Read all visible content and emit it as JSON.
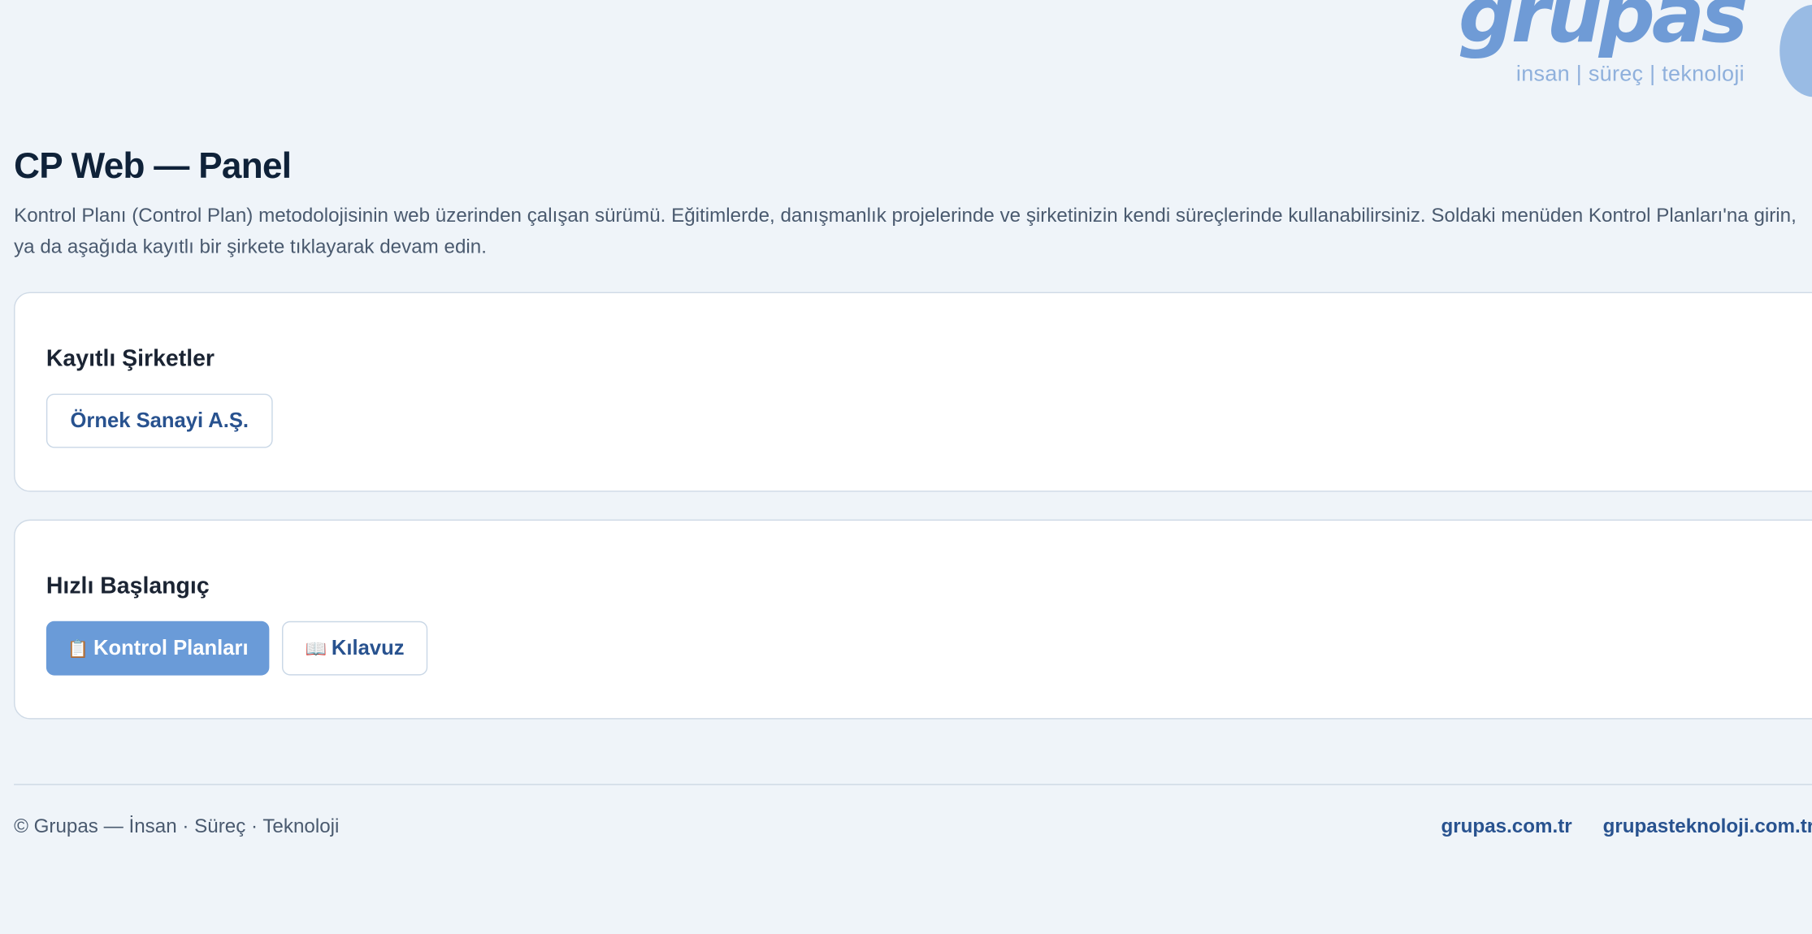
{
  "logo": {
    "word": "grupas",
    "tagline": "insan | süreç | teknoloji"
  },
  "page": {
    "title": "CP Web — Panel",
    "intro": "Kontrol Planı (Control Plan) metodolojisinin web üzerinden çalışan sürümü. Eğitimlerde, danışmanlık projelerinde ve şirketinizin kendi süreçlerinde kullanabilirsiniz. Soldaki menüden Kontrol Planları'na girin, ya da aşağıda kayıtlı bir şirkete tıklayarak devam edin."
  },
  "companies": {
    "title": "Kayıtlı Şirketler",
    "items": [
      "Örnek Sanayi A.Ş."
    ]
  },
  "quick_start": {
    "title": "Hızlı Başlangıç",
    "control_plans": {
      "icon": "clipboard-icon",
      "glyph": "📋",
      "label": "Kontrol Planları"
    },
    "guide": {
      "icon": "book-icon",
      "glyph": "📖",
      "label": "Kılavuz"
    }
  },
  "footer": {
    "copyright": "© Grupas — İnsan · Süreç · Teknoloji",
    "links": [
      "grupas.com.tr",
      "grupasteknoloji.com.tr"
    ]
  },
  "colors": {
    "background": "#eff4f9",
    "primary": "#6a9bd8",
    "link": "#28528f",
    "title": "#0f2239"
  }
}
